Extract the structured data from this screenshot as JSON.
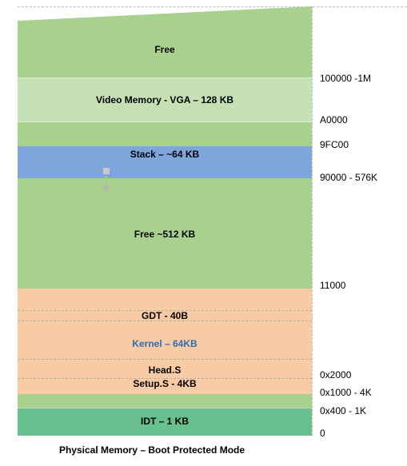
{
  "diagram": {
    "caption": "Physical Memory – Boot Protected Mode",
    "colors": {
      "green": "#a9d18e",
      "light_green": "#c5e0b4",
      "blue": "#7ea6dc",
      "orange": "#f8cba4",
      "teal": "#66c18f",
      "kernel_text": "#2e6db4"
    },
    "labels": {
      "free_top": "Free",
      "video": "Video Memory - VGA – 128 KB",
      "stack": "Stack – ~64 KB",
      "free_mid": "Free  ~512 KB",
      "gdt": "GDT - 40B",
      "kernel": "Kernel – 64KB",
      "head": "Head.S",
      "setup": "Setup.S  - 4KB",
      "idt": "IDT – 1 KB"
    },
    "addresses": {
      "a100000": "100000 -1M",
      "aA0000": "A0000",
      "a9FC00": "9FC00",
      "a90000": "90000 - 576K",
      "a11000": "11000",
      "a2000": "0x2000",
      "a1000": "0x1000 - 4K",
      "a400": "0x400 - 1K",
      "a0": "0"
    }
  }
}
